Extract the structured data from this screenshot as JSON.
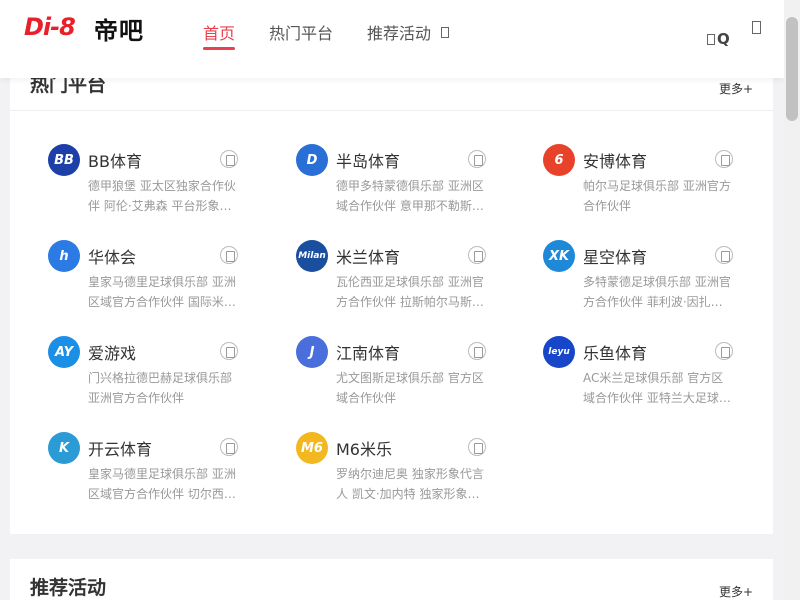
{
  "header": {
    "logo_text": "Di-8",
    "logo_cn": "帝吧",
    "nav": [
      {
        "label": "首页",
        "active": true
      },
      {
        "label": "热门平台",
        "active": false
      },
      {
        "label": "推荐活动",
        "active": false
      }
    ],
    "search_label": "Q"
  },
  "platforms_section": {
    "title": "热门平台",
    "more_label": "更多+",
    "items": [
      {
        "name": "BB体育",
        "desc": "德甲狼堡 亚太区独家合作伙伴 阿伦·艾弗森 平台形象…",
        "icon_text": "BB",
        "icon_color": "#1d3fa8"
      },
      {
        "name": "半岛体育",
        "desc": "德甲多特蒙德俱乐部 亚洲区域合作伙伴 意甲那不勒斯…",
        "icon_text": "D",
        "icon_color": "#2a6fd6"
      },
      {
        "name": "安博体育",
        "desc": "帕尔马足球俱乐部 亚洲官方合作伙伴",
        "icon_text": "6",
        "icon_color": "#e8432a"
      },
      {
        "name": "华体会",
        "desc": "皇家马德里足球俱乐部 亚洲区域官方合作伙伴 国际米…",
        "icon_text": "h",
        "icon_color": "#2c7be5"
      },
      {
        "name": "米兰体育",
        "desc": "瓦伦西亚足球俱乐部 亚洲官方合作伙伴 拉斯帕尔马斯…",
        "icon_text": "Milan",
        "icon_color": "#1a4fa0"
      },
      {
        "name": "星空体育",
        "desc": "多特蒙德足球俱乐部 亚洲官方合作伙伴 菲利波·因扎…",
        "icon_text": "XK",
        "icon_color": "#1e88d9"
      },
      {
        "name": "爱游戏",
        "desc": "门兴格拉德巴赫足球俱乐部 亚洲官方合作伙伴",
        "icon_text": "AY",
        "icon_color": "#1b8fe6"
      },
      {
        "name": "江南体育",
        "desc": "尤文图斯足球俱乐部 官方区域合作伙伴",
        "icon_text": "J",
        "icon_color": "#4a6fdc"
      },
      {
        "name": "乐鱼体育",
        "desc": "AC米兰足球俱乐部 官方区域合作伙伴 亚特兰大足球…",
        "icon_text": "leyu",
        "icon_color": "#1746c8"
      },
      {
        "name": "开云体育",
        "desc": "皇家马德里足球俱乐部 亚洲区域官方合作伙伴 切尔西…",
        "icon_text": "K",
        "icon_color": "#2b9bd6"
      },
      {
        "name": "M6米乐",
        "desc": "罗纳尔迪尼奥 独家形象代言人 凯文·加内特 独家形象…",
        "icon_text": "M6",
        "icon_color": "#f3b81f"
      }
    ]
  },
  "events_section": {
    "title": "推荐活动",
    "more_label": "更多+"
  },
  "colors": {
    "accent": "#e8414d",
    "brand_red": "#e8202a",
    "background": "#f2f2f4"
  }
}
